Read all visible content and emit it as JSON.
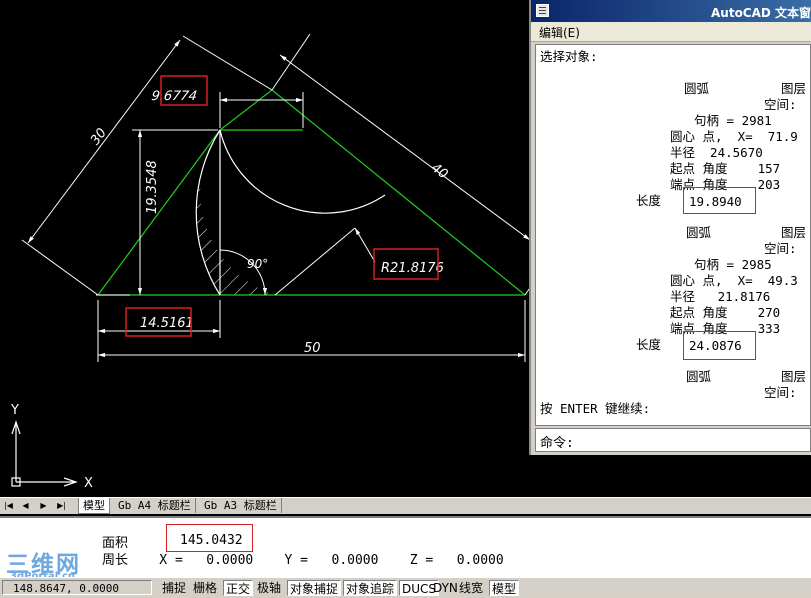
{
  "drawing": {
    "dims": {
      "top_width": "9.6774",
      "left_side": "30",
      "right_side": "40",
      "height": "19.3548",
      "bottom_left": "14.5161",
      "base": "50",
      "radius": "R21.8176",
      "angle": "90°"
    },
    "ucs": {
      "y": "Y",
      "x": "X"
    },
    "colors": {
      "background": "#000000",
      "lines": "#ffffff",
      "triangle": "#22cc22",
      "highlight": "#d82020"
    }
  },
  "text_window": {
    "title": "AutoCAD 文本窗口",
    "menu_edit": "编辑(E)",
    "lines": [
      "选择对象:",
      "圆弧",
      "图层",
      "空间:",
      "句柄 = 2981",
      "圆心 点,  X=  71.9",
      "半径  24.5670",
      "起点 角度    157",
      "端点 角度    203",
      "长度",
      "19.8940",
      "圆弧",
      "图层",
      "空间:",
      "句柄 = 2985",
      "圆心 点,  X=  49.3",
      "半径   21.8176",
      "起点 角度    270",
      "端点 角度    333",
      "长度",
      "24.0876",
      "圆弧",
      "图层",
      "空间:",
      "按 ENTER 键继续:"
    ],
    "command_prompt": "命令:"
  },
  "tabs": {
    "nav": [
      "|◀",
      "◀",
      "▶",
      "▶|"
    ],
    "items": [
      "模型",
      "Gb A4 标题栏",
      "Gb A3 标题栏"
    ]
  },
  "command_line": {
    "area_label": "面积",
    "area_value": "145.0432",
    "line2": "周长    X =   0.0000    Y =   0.0000    Z =   0.0000"
  },
  "watermark": {
    "big": "三维网",
    "small": "3dPortal.cn"
  },
  "status": {
    "coords": "148.8647,  0.0000",
    "buttons": [
      {
        "label": "捕捉",
        "on": false
      },
      {
        "label": "栅格",
        "on": false
      },
      {
        "label": "正交",
        "on": true
      },
      {
        "label": "极轴",
        "on": false
      },
      {
        "label": "对象捕捉",
        "on": true
      },
      {
        "label": "对象追踪",
        "on": true
      },
      {
        "label": "DUCS",
        "on": true
      },
      {
        "label": "DYN",
        "on": false
      },
      {
        "label": "线宽",
        "on": false
      },
      {
        "label": "模型",
        "on": true
      }
    ]
  }
}
